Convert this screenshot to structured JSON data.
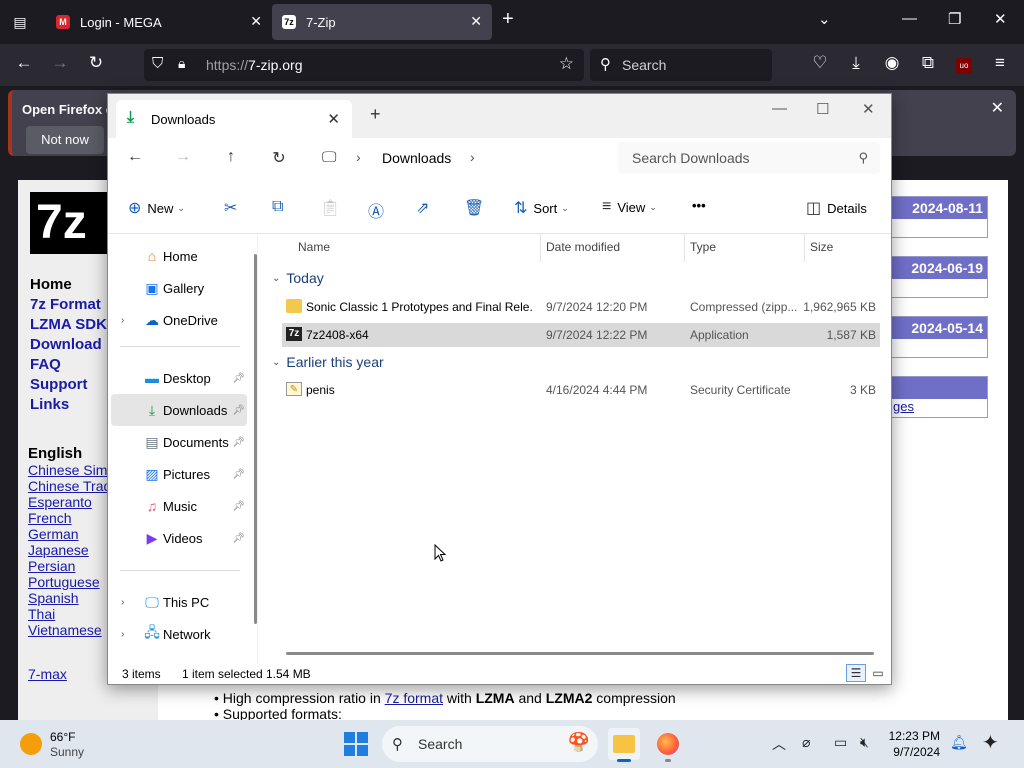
{
  "browser": {
    "tabs": [
      {
        "title": "Login - MEGA",
        "favicon": "M"
      },
      {
        "title": "7-Zip",
        "favicon": "7z"
      }
    ],
    "url_protocol": "https://",
    "url_host": "7-zip.org",
    "search_placeholder": "Search"
  },
  "notification": {
    "text": "Open Firefox ev",
    "not_now": "Not now"
  },
  "website": {
    "logo": "7z",
    "nav": [
      "Home",
      "7z Format",
      "LZMA SDK",
      "Download",
      "FAQ",
      "Support",
      "Links"
    ],
    "lang_heading": "English",
    "languages": [
      "Chinese Simp",
      "Chinese Trad",
      "Esperanto",
      "French",
      "German",
      "Japanese",
      "Persian",
      "Portuguese",
      "Spanish",
      "Thai",
      "Vietnamese"
    ],
    "extra_link": "7-max",
    "dates": [
      "2024-08-11",
      "2024-06-19",
      "2024-05-14"
    ],
    "partial_link": "ges",
    "bullet1_pre": "High compression ratio in ",
    "bullet1_link": "7z format",
    "bullet1_mid": " with ",
    "bullet1_b1": "LZMA",
    "bullet1_and": " and ",
    "bullet1_b2": "LZMA2",
    "bullet1_post": " compression",
    "bullet2": "Supported formats:"
  },
  "explorer": {
    "tab_title": "Downloads",
    "breadcrumb": "Downloads",
    "search_placeholder": "Search Downloads",
    "commands": {
      "new": "New",
      "sort": "Sort",
      "view": "View",
      "more": "•••",
      "details": "Details"
    },
    "nav_pane": {
      "home": "Home",
      "gallery": "Gallery",
      "onedrive": "OneDrive",
      "desktop": "Desktop",
      "downloads": "Downloads",
      "documents": "Documents",
      "pictures": "Pictures",
      "music": "Music",
      "videos": "Videos",
      "this_pc": "This PC",
      "network": "Network"
    },
    "columns": {
      "name": "Name",
      "date": "Date modified",
      "type": "Type",
      "size": "Size"
    },
    "groups": {
      "today": "Today",
      "earlier": "Earlier this year"
    },
    "files": [
      {
        "name": "Sonic Classic 1 Prototypes and Final Rele...",
        "date": "9/7/2024 12:20 PM",
        "type": "Compressed (zipp...",
        "size": "1,962,965 KB"
      },
      {
        "name": "7z2408-x64",
        "date": "9/7/2024 12:22 PM",
        "type": "Application",
        "size": "1,587 KB"
      },
      {
        "name": "penis",
        "date": "4/16/2024 4:44 PM",
        "type": "Security Certificate",
        "size": "3 KB"
      }
    ],
    "status": {
      "items": "3 items",
      "selected": "1 item selected",
      "size": "1.54 MB"
    }
  },
  "taskbar": {
    "temp": "66°F",
    "condition": "Sunny",
    "search": "Search",
    "time": "12:23 PM",
    "date": "9/7/2024"
  }
}
